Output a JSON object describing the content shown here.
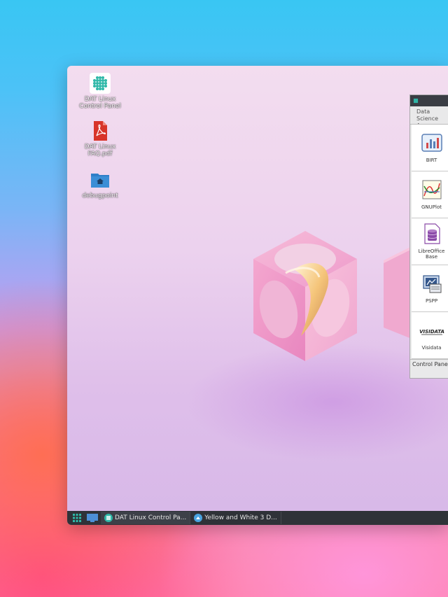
{
  "desktop": {
    "icons": [
      {
        "label": "DAT Linux Control Panel",
        "icon": "control-panel-icon"
      },
      {
        "label": "DAT Linux FAQ.pdf",
        "icon": "pdf-file-icon"
      },
      {
        "label": "debugpoint",
        "icon": "home-folder-icon"
      }
    ]
  },
  "panel": {
    "category": "Data Science\nApps",
    "apps": [
      {
        "name": "BIRT",
        "icon": "birt-icon"
      },
      {
        "name": "GNUPlot",
        "icon": "gnuplot-icon"
      },
      {
        "name": "LibreOffice Base",
        "icon": "libreoffice-base-icon"
      },
      {
        "name": "PSPP",
        "icon": "pspp-icon"
      },
      {
        "name": "Visidata",
        "icon": "visidata-icon"
      }
    ],
    "footer": "Control Panel"
  },
  "taskbar": {
    "tasks": [
      {
        "label": "DAT Linux Control Pa..."
      },
      {
        "label": "Yellow and White 3 D..."
      }
    ]
  },
  "colors": {
    "taskbar": "#2f3238",
    "accent_teal": "#2fb8a8",
    "pdf_red": "#d8352a",
    "folder_blue": "#3b8ed6"
  }
}
